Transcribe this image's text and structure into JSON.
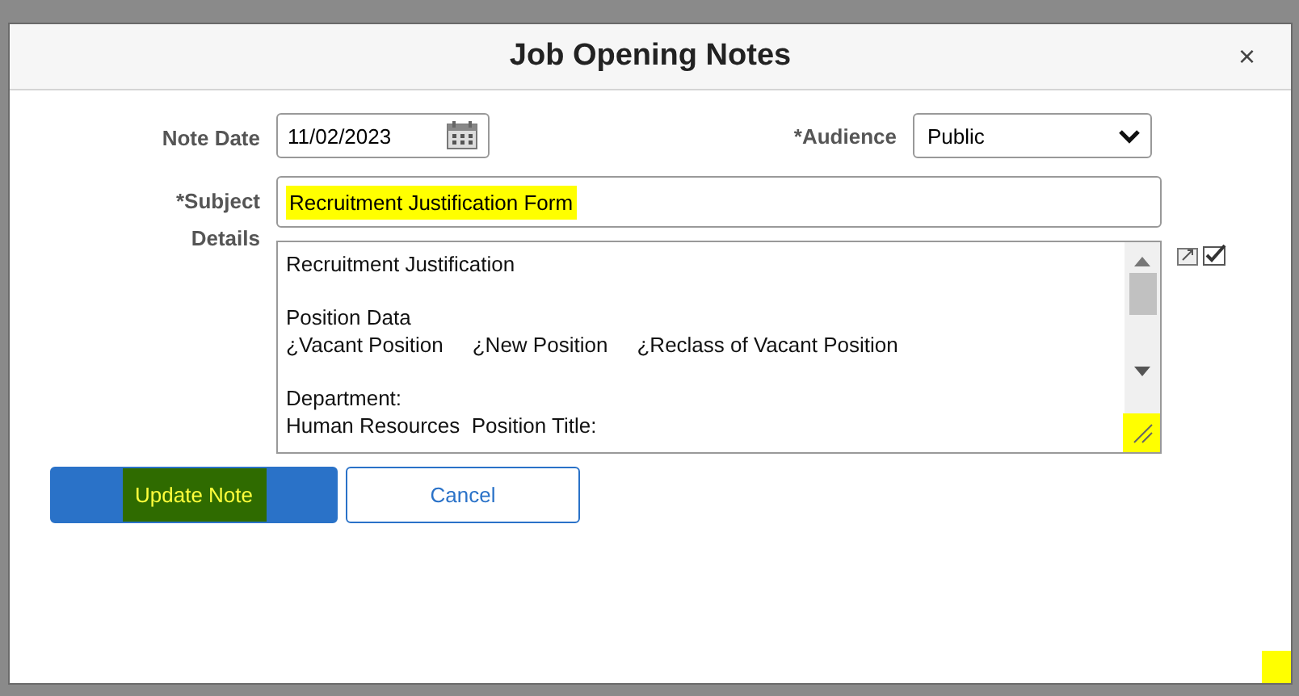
{
  "dialog": {
    "title": "Job Opening Notes",
    "close": "×"
  },
  "note_date": {
    "label": "Note Date",
    "value": "11/02/2023"
  },
  "audience": {
    "label": "*Audience",
    "value": "Public"
  },
  "subject": {
    "label": "*Subject",
    "value": "Recruitment Justification Form",
    "highlighted": true
  },
  "details": {
    "label": "Details",
    "paragraphs": [
      [
        "Recruitment Justification"
      ],
      [
        "Position Data",
        "¿Vacant Position     ¿New Position     ¿Reclass of Vacant Position"
      ],
      [
        "Department:",
        "Human Resources  Position Title:"
      ]
    ]
  },
  "buttons": [
    {
      "label": "Update Note",
      "kind": "primary",
      "highlighted": true
    },
    {
      "label": "Cancel",
      "kind": "secondary",
      "highlighted": false
    }
  ]
}
